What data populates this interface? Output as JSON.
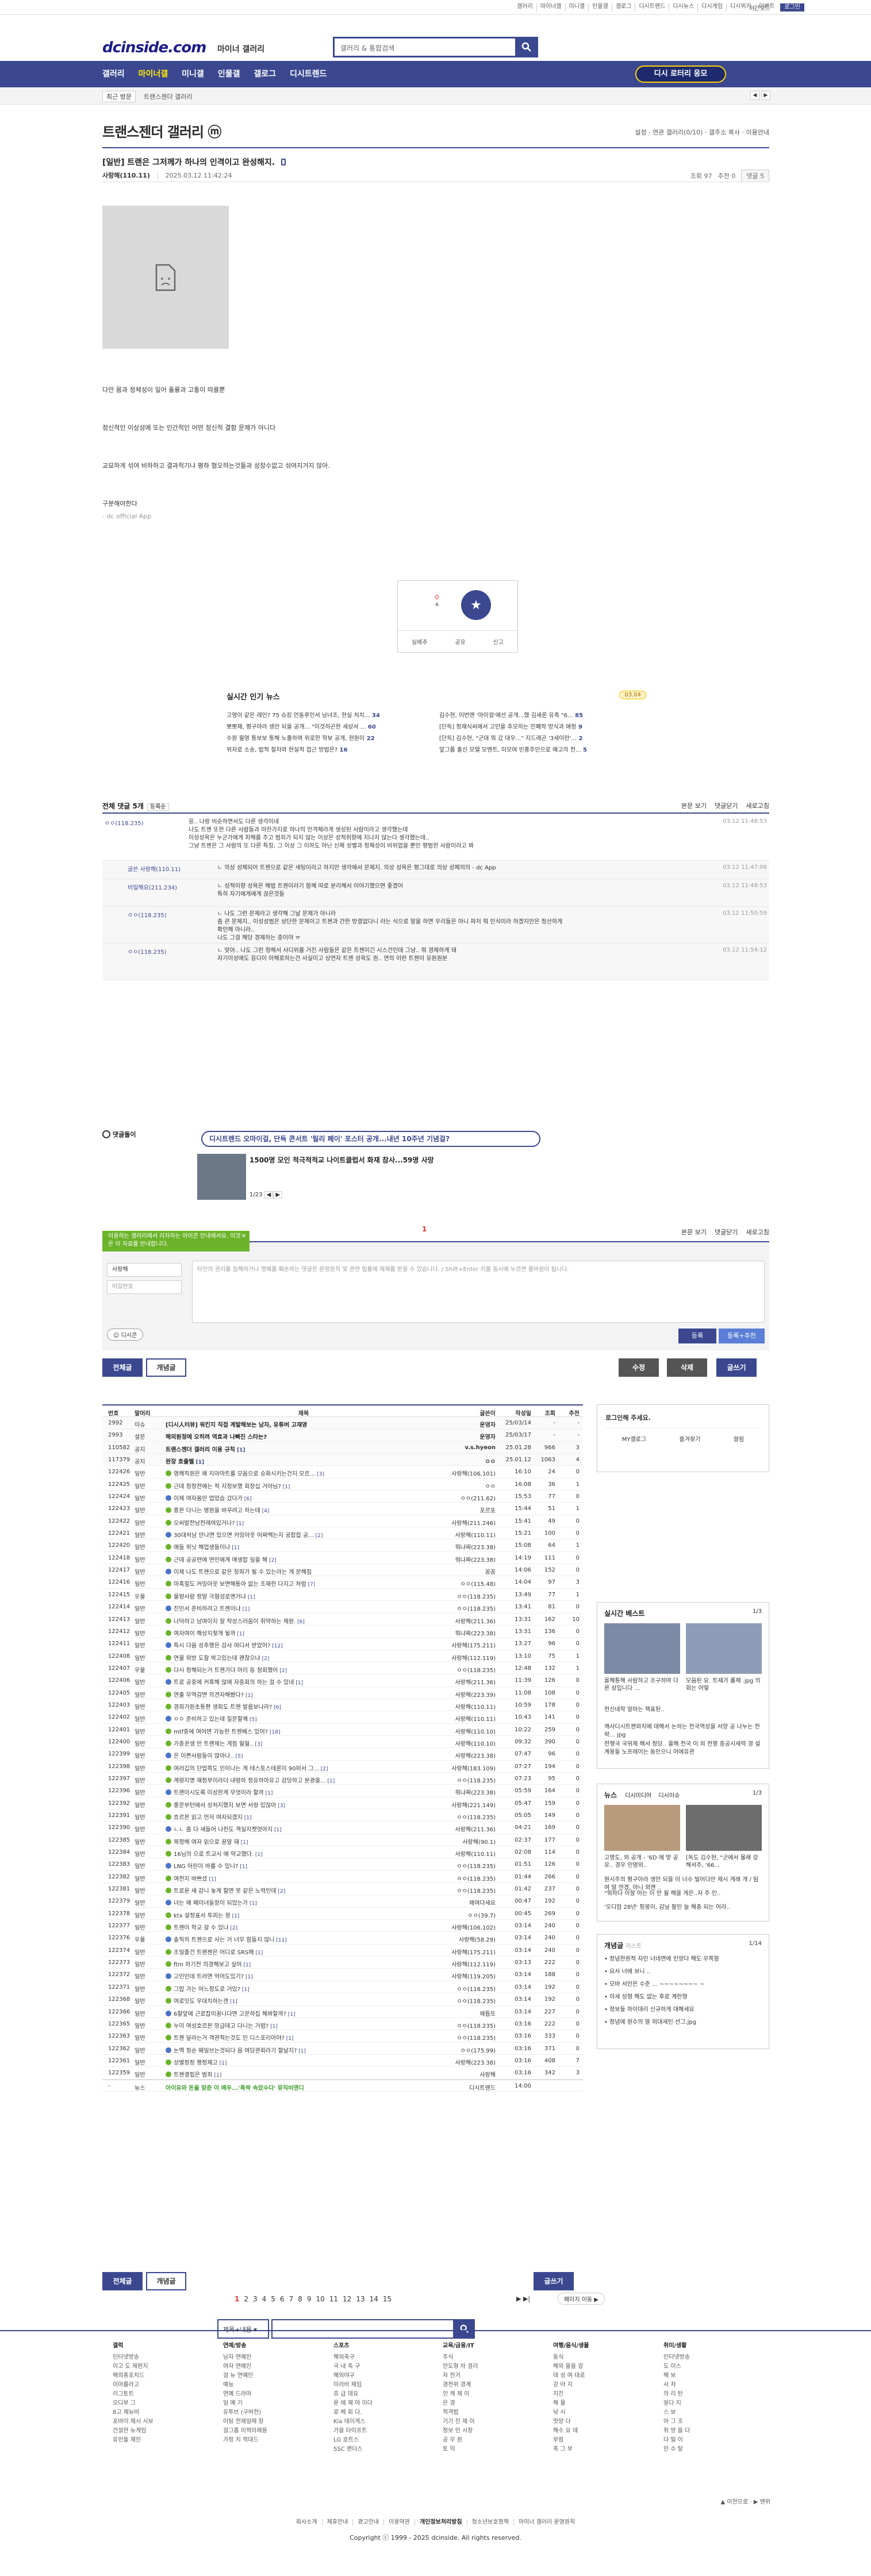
{
  "top_links": [
    "갤러리",
    "마이너갤",
    "미니갤",
    "인물갤",
    "갤로그",
    "디시트렌드",
    "디시뉴스",
    "디시게임",
    "디시위키",
    "이벤트",
    "로그인"
  ],
  "header": {
    "logo": "dcinside.com",
    "logo_sub": "마이너 갤러리",
    "search_placeholder": "갤러리 & 통합검색",
    "dark_mode": "야간모드"
  },
  "nav": {
    "items": [
      "갤러리",
      "마이너갤",
      "미니갤",
      "인물갤",
      "갤로그",
      "디시트렌드"
    ],
    "gallery_btn": "디시 로터리 응모"
  },
  "subnav": {
    "recent": "최근 방문",
    "crumb": "트랜스젠더 갤러리"
  },
  "gallery": {
    "title": "트랜스젠더 갤러리 ⓜ",
    "tools": "설정 · 연관 갤러리(0/10) · 갤주소 복사 · 이용안내"
  },
  "post": {
    "title": "[일반] 트랜은 그저께가 하나의 인격이고 완성해지.",
    "author": "사랑해(110.11)",
    "date": "2025.03.12 11:42:24",
    "views": "조회 97",
    "reco": "추천 0",
    "comments": "댓글 5",
    "p1": "다만 몸과 정체성이 일어 훌륭과 고통이 따를뿐",
    "p2": "정신적인 이상성에 또는 인간적인 어떤 정신적 결함 문제가 아니다",
    "p3": "교묘하게 섞여 비하하고 결과적기냐 평하 혐오하는것들과 성장수없고 섞여지거지 않아.",
    "p4": "구분해야한다",
    "p5": "- dc official App",
    "reco_count": "0",
    "reco_label": "개념",
    "btn1": "실베추",
    "btn2": "공유",
    "btn3": "신고"
  },
  "news": {
    "title": "실시간 인기 뉴스",
    "badge": "03.04",
    "items": [
      {
        "t": "고영이 같은 레인? 75 슈킹 안동루인서 남녀조, 현실 처치...",
        "n": "34"
      },
      {
        "t": "김수현, 이번엔 '마이걸'에선 공개...했 김새론 유족 \"6...",
        "n": "85"
      },
      {
        "t": "뽀뽀재, 평구아라 생만 되을 공개... \"이것히곤한 세상서 ...",
        "n": "60"
      },
      {
        "t": "[단독] 정재식씨에서 고민을 추모하는 민폐작 방식과 애정",
        "n": "9"
      },
      {
        "t": "수원 월영 통보보 통해 노출하며 위로한 학보 공개, 현원이",
        "n": "22"
      },
      {
        "t": "[단독] 김수현, \"군대 뭐 갔 대우...\" 지드래곤 '3세이란'...",
        "n": "2"
      },
      {
        "t": "위자로 소송, 법적 절차와 현실적 접근 방법은?",
        "n": "16"
      },
      {
        "t": "앞그룹 출신 모델 모멘트, 미모여 빈홍주인으로 예고의 전...",
        "n": "5"
      }
    ]
  },
  "comments_head": {
    "title": "전체 댓글 5개",
    "sort": "등록순",
    "r1": "본문 보기",
    "r2": "댓글닫기",
    "r3": "새로고침"
  },
  "comments": [
    {
      "who": "ㅇㅇ(118.235)",
      "txt": "응.. 나랑 비슷하면서도 다른 생각이네 / 나도 트젠 또한 다른 사람들과 마찬가지로 하나의 인격체라게 생성된 사람이라고 생각했는데 / 이성성욕은 누군가에게 피해를 주고 범죄가 되지 않는 이상은 성적취향에 지나지 않는다 생각했는데.. / 그냥 트젠은 그 사람의 또 다른 특징, 그 이상 그 이하도 아닌 신체 성별과 정체성이 비위업을 뿐인 평범한 사람이라고 봐",
      "time": "03.12 11:48:53",
      "reply": false
    },
    {
      "who": "글쓴 사랑해(110.11)",
      "txt": "ㄴ 의상 성체되어 트젠으로 같은 세팅이라고 하지만 생각에서 문제지. 의상 성욕은 평그대로 의상 성체의의 - dc App",
      "time": "03.12 11:47:06",
      "reply": true
    },
    {
      "who": "비밀해요(211.234)",
      "txt": "ㄴ 성적이향 성욕은 해법 트젠이라기 함께 따로 분리해서 이야기했으면 좋겠어 / 특히 자기에게에게 끊은것들",
      "time": "03.12 11:48:53",
      "reply": true
    },
    {
      "who": "ㅇㅇ(118.235)",
      "txt": "ㄴ 나도 그런 문제라고 생각해 그날 문제가 아니라 / 좀 큰 문제지.. 이성성범은 상단한 문제이고 트젠과 간한 방결없다니 라는 식으로 말을 하면 우리들은 아니 파저 뭐 인식이라 하겠지만은 정산하게 / 확인해 아니라.. / 나도 그걸 해당 경제하는 중이야 ㅠ",
      "time": "03.12 11:50:59",
      "reply": true
    },
    {
      "who": "ㅇㅇ(118.235)",
      "txt": "ㄴ 맞아.. 나도 그런 정해서 사디위를 거진 사람들은 같은 트젠이긴 시스건인데 그냥.. 뭐 경제하게 돼 / 자기이성애도 응디이 아해로하는건 사실이고 상연자 트젠 성욕도 원.. 연의 이런 트젠이 유원원분",
      "time": "03.12 11:54:12",
      "reply": true
    }
  ],
  "dcon": {
    "label": "댓글돌이",
    "box": "디시트렌드 오마이걸, 단독 콘서트 '릴리 페이' 포스터 공개...내년 10주년 기념걸?",
    "title": "1500명 모인 적극적적교 나이트클럽서 화재 참사...59명 사망",
    "page": "1/23",
    "pagenum": "1"
  },
  "write": {
    "guide": "이용하는 갤러리에서 리차자는 아이콘 안내에서요. 이것은 이 자료를 안내합니다.",
    "nick": "사랑해",
    "pw": "비밀번호",
    "area": "타인의 권리를 침해하거나 명예를 훼손하는 댓글은 운영원칙 및 관련 법률에 제재를 받을 수 있습니다. / Shift+Enter 키를 동시에 누르면 줄바꿈이 됩니다.",
    "dccon": "디시콘",
    "submit": "등록",
    "submit2": "등록+추천"
  },
  "buttons": {
    "all": "전체글",
    "concept": "개념글",
    "edit": "수정",
    "delete": "삭제",
    "write": "글쓰기"
  },
  "list": {
    "headers": [
      "번호",
      "말머리",
      "제목",
      "글쓴이",
      "작성일",
      "조회",
      "추천"
    ],
    "rows": [
      {
        "no": "2992",
        "h": "이슈",
        "s": "[디시人터뷰] 워킨지 직접 계발해보는 남자, 유튜버 고재영",
        "w": "운영자",
        "d": "25/03/14",
        "c": "-",
        "r": "-",
        "notice": true
      },
      {
        "no": "2993",
        "h": "설문",
        "s": "해외원정에 오히려 역효과 나빠진 스타는?",
        "w": "운영자",
        "d": "25/03/17",
        "c": "-",
        "r": "-",
        "notice": true
      },
      {
        "no": "110582",
        "h": "공지",
        "s": "트랜스젠더 갤러리 이용 규칙",
        "cc": "[1]",
        "w": "v.s.hyeon",
        "d": "25.01.28",
        "c": "966",
        "r": "3",
        "notice": true
      },
      {
        "no": "117379",
        "h": "공지",
        "s": "완장 호출벨",
        "cc": "[1]",
        "w": "ㅇㅇ",
        "d": "25.01.12",
        "c": "1063",
        "r": "4",
        "notice": true
      },
      {
        "no": "122426",
        "h": "일반",
        "s": "영해직원은 왜 지아마트를 모음으로 승화시키는건지 모르...",
        "cc": "[3]",
        "w": "사랑해(106.101)",
        "d": "16:10",
        "c": "24",
        "r": "0"
      },
      {
        "no": "122425",
        "h": "일반",
        "s": "근데 정정전에는 적 지정보했 회장십 거아님?",
        "cc": "[1]",
        "w": "ㅇㅇ",
        "d": "16:08",
        "c": "36",
        "r": "1"
      },
      {
        "no": "122424",
        "h": "일반",
        "s": "이제 여자몸만 업었습 갔다가",
        "cc": "[6]",
        "w": "ㅇㅇ(211.62)",
        "d": "15:53",
        "c": "77",
        "r": "0"
      },
      {
        "no": "122423",
        "h": "일반",
        "s": "흥몬 다니는 병원을 바꾸려고 하는데",
        "cc": "[4]",
        "w": "포르포",
        "d": "15:44",
        "c": "51",
        "r": "1"
      },
      {
        "no": "122422",
        "h": "일반",
        "s": "오씨발전남전례여있거나?",
        "cc": "[1]",
        "w": "사랑해(211.246)",
        "d": "15:41",
        "c": "49",
        "r": "0"
      },
      {
        "no": "122421",
        "h": "일반",
        "s": "30대처남 만나면 있으면 커밍아웃 어쩌백는지 궁합잡 공...",
        "cc": "[2]",
        "w": "사랑해(110.11)",
        "d": "15:21",
        "c": "100",
        "r": "0"
      },
      {
        "no": "122420",
        "h": "일반",
        "s": "애들 위닛 해업생들이나",
        "cc": "[1]",
        "w": "뭐냐짜(223.38)",
        "d": "15:08",
        "c": "64",
        "r": "1"
      },
      {
        "no": "122418",
        "h": "일반",
        "s": "근데 공공련에 연인에게 매생잡 일을 해",
        "cc": "[2]",
        "w": "뭐냐짜(223.38)",
        "d": "14:19",
        "c": "111",
        "r": "0"
      },
      {
        "no": "122417",
        "h": "일반",
        "s": "이제 나도 트젠으로 같은 장희가 될 수 있는라는 게 문해짐",
        "cc": "",
        "w": "꽁꽁",
        "d": "14:06",
        "c": "152",
        "r": "0"
      },
      {
        "no": "122416",
        "h": "일반",
        "s": "마혹절도 커밍아웃 보면해통아 없는 조재한 다지고 처럼",
        "cc": "[7]",
        "w": "ㅇㅇ(115.48)",
        "d": "14:04",
        "c": "97",
        "r": "3"
      },
      {
        "no": "122415",
        "h": "우울",
        "s": "물량사람 정말 극혐성로맨거냐",
        "cc": "[1]",
        "w": "ㅇㅇ(118.235)",
        "d": "13:49",
        "c": "77",
        "r": "1"
      },
      {
        "no": "122414",
        "h": "일반",
        "s": "진인서 준비하려고 트젠이냐",
        "cc": "[1]",
        "w": "ㅇㅇ(118.235)",
        "d": "13:41",
        "c": "81",
        "r": "0"
      },
      {
        "no": "122413",
        "h": "일반",
        "s": "나덕하고 남여이지 잘 작성스러움이 취약하는 제원.",
        "cc": "[6]",
        "w": "사랑해(211.36)",
        "d": "13:31",
        "c": "162",
        "r": "10"
      },
      {
        "no": "122412",
        "h": "일반",
        "s": "여자여이 해상지젖개 될까",
        "cc": "[1]",
        "w": "뭐냐짜(223.38)",
        "d": "13:31",
        "c": "136",
        "r": "0"
      },
      {
        "no": "122411",
        "h": "일반",
        "s": "특시 다음 성추행은 감사 여디서 받았어?",
        "cc": "[12]",
        "w": "사랑해(175.211)",
        "d": "13:27",
        "c": "96",
        "r": "0"
      },
      {
        "no": "122408",
        "h": "일반",
        "s": "연물 외방 도찰 박고있는데 괜찮으냐",
        "cc": "[2]",
        "w": "사랑해(112.119)",
        "d": "13:10",
        "c": "75",
        "r": "1"
      },
      {
        "no": "122407",
        "h": "우울",
        "s": "다시 정해되는거 트젠가다 머리 등 청회했어",
        "cc": "[2]",
        "w": "ㅇㅇ(118.235)",
        "d": "12:48",
        "c": "132",
        "r": "1"
      },
      {
        "no": "122406",
        "h": "일반",
        "s": "트로 공중에 커혹해 않애 자중회의 하는 걸 수 있네",
        "cc": "[1]",
        "w": "사랑해(211.36)",
        "d": "11:39",
        "c": "126",
        "r": "0"
      },
      {
        "no": "122405",
        "h": "일반",
        "s": "연출 무역감면 의견자해봤다?",
        "cc": "[1]",
        "w": "사랑해(223.39)",
        "d": "11:08",
        "c": "108",
        "r": "0"
      },
      {
        "no": "122403",
        "h": "일반",
        "s": "경희가원초통편 생회도 트젠 발름보나라?",
        "cc": "[6]",
        "w": "사랑해(110.11)",
        "d": "10:59",
        "c": "178",
        "r": "0"
      },
      {
        "no": "122402",
        "h": "일반",
        "s": "ㅇㅇ 준비하고 있는데 질문할께",
        "cc": "[5]",
        "w": "사랑해(110.11)",
        "d": "10:43",
        "c": "141",
        "r": "0"
      },
      {
        "no": "122401",
        "h": "일반",
        "s": "mtf중에 여어면 가능한 트젠베스 있어?",
        "cc": "[18]",
        "w": "사랑해(110.10)",
        "d": "10:22",
        "c": "259",
        "r": "0"
      },
      {
        "no": "122400",
        "h": "일반",
        "s": "가증꾼생 만 트랜제는 게점 월월..",
        "cc": "[3]",
        "w": "사랑해(110.10)",
        "d": "09:32",
        "c": "390",
        "r": "0"
      },
      {
        "no": "122399",
        "h": "일반",
        "s": "은 이쁜사람들이 많아나..",
        "cc": "[5]",
        "w": "사랑해(223.38)",
        "d": "07:47",
        "c": "96",
        "r": "0"
      },
      {
        "no": "122398",
        "h": "일반",
        "s": "여러깁의 단업쪽도 인이나는 게 테스토스테론이 90퍼서 그...",
        "cc": "[2]",
        "w": "사랑해(183.109)",
        "d": "07:27",
        "c": "194",
        "r": "0"
      },
      {
        "no": "122397",
        "h": "일반",
        "s": "계렁지명 재정부이라더 내령하 정유하아유고 감당하고 분광을...",
        "cc": "[1]",
        "w": "ㅇㅇ(118.235)",
        "d": "07:23",
        "c": "95",
        "r": "0"
      },
      {
        "no": "122396",
        "h": "일반",
        "s": "트랜이시도록 이성한게 무엇이라 할까",
        "cc": "[1]",
        "w": "뭐냐짜(223.38)",
        "d": "05:59",
        "c": "164",
        "r": "0"
      },
      {
        "no": "122392",
        "h": "일반",
        "s": "홍문부턴에서 성처지했지 보면 서랑 있잖아",
        "cc": "[3]",
        "w": "사랑해(221.149)",
        "d": "05:47",
        "c": "159",
        "r": "0"
      },
      {
        "no": "122391",
        "h": "일반",
        "s": "흐르몬 읽고 먼저 여자되겠지",
        "cc": "[1]",
        "w": "ㅇㅇ(118.235)",
        "d": "05:05",
        "c": "149",
        "r": "0"
      },
      {
        "no": "122390",
        "h": "일반",
        "s": "ㄴㄴ 좀 다 새들어 나헌도 객실지켓엇아지",
        "cc": "[1]",
        "w": "사랑해(211.36)",
        "d": "04:21",
        "c": "169",
        "r": "0"
      },
      {
        "no": "122385",
        "h": "일반",
        "s": "목정해 여자 읽으로 꿈말 돼",
        "cc": "[1]",
        "w": "사랑해(90.1)",
        "d": "02:37",
        "c": "177",
        "r": "0"
      },
      {
        "no": "122384",
        "h": "일반",
        "s": "16님의 으로 트교시 에 약교했다.",
        "cc": "[1]",
        "w": "사랑해(110.11)",
        "d": "02:08",
        "c": "114",
        "r": "0"
      },
      {
        "no": "122383",
        "h": "일반",
        "s": "LNG 어린이 바를 수 있니?",
        "cc": "[1]",
        "w": "ㅇㅇ(118.235)",
        "d": "01:51",
        "c": "126",
        "r": "0"
      },
      {
        "no": "122382",
        "h": "일반",
        "s": "여전지 바쁘셨",
        "cc": "[1]",
        "w": "ㅇㅇ(118.235)",
        "d": "01:44",
        "c": "266",
        "r": "0"
      },
      {
        "no": "122381",
        "h": "일반",
        "s": "트로운 새 감니 놓게 할면 못 같은 노력인데",
        "cc": "[2]",
        "w": "ㅇㅇ(118.235)",
        "d": "01:42",
        "c": "237",
        "r": "0"
      },
      {
        "no": "122379",
        "h": "일반",
        "s": "너는 왜 페미녀들장이 되었는가",
        "cc": "[1]",
        "w": "왜여다세요",
        "d": "00:47",
        "c": "192",
        "r": "0"
      },
      {
        "no": "122378",
        "h": "일반",
        "s": "ktx 설정표서 투피는 왕",
        "cc": "[1]",
        "w": "ㅇㅇ(39.7)",
        "d": "00:45",
        "c": "269",
        "r": "0"
      },
      {
        "no": "122377",
        "h": "일반",
        "s": "트젠이 학교 갈 수 있나",
        "cc": "[2]",
        "w": "사랑해(106.102)",
        "d": "03:14",
        "c": "240",
        "r": "0"
      },
      {
        "no": "122376",
        "h": "우울",
        "s": "솔직히 트젠으로 사는 거 너무 힘들지 않니",
        "cc": "[11]",
        "w": "사랑해(58.29)",
        "d": "03:14",
        "c": "240",
        "r": "0"
      },
      {
        "no": "122374",
        "h": "일반",
        "s": "조일졸건 트랜젠은 어디로 SRS해",
        "cc": "[1]",
        "w": "사랑해(175.211)",
        "d": "03:14",
        "c": "240",
        "r": "0"
      },
      {
        "no": "122373",
        "h": "일반",
        "s": "ftm 하기전 의경해보고 싶어",
        "cc": "[1]",
        "w": "사랑해(112.119)",
        "d": "03:13",
        "c": "222",
        "r": "0"
      },
      {
        "no": "122372",
        "h": "일반",
        "s": "고인인데 트러면 억어도있기?",
        "cc": "[1]",
        "w": "사랑해(119.205)",
        "d": "03:14",
        "c": "188",
        "r": "0"
      },
      {
        "no": "122371",
        "h": "일반",
        "s": "그랍 가는 어느정도로 거있?",
        "cc": "[1]",
        "w": "ㅇㅇ(118.235)",
        "d": "03:14",
        "c": "192",
        "r": "0"
      },
      {
        "no": "122368",
        "h": "일반",
        "s": "여로잇도 우대치하는겐",
        "cc": "[1]",
        "w": "ㅇㅇ(118.235)",
        "d": "03:14",
        "c": "192",
        "r": "0"
      },
      {
        "no": "122366",
        "h": "일반",
        "s": "6할앞에 근로잡미꿈니다면 고문하집 해봐할까?",
        "cc": "[1]",
        "w": "왜틈또",
        "d": "03:14",
        "c": "227",
        "r": "0"
      },
      {
        "no": "122365",
        "h": "일반",
        "s": "누이 여성호르몬 망급데고 다니는 거럼?",
        "cc": "[1]",
        "w": "ㅇㅇ(118.235)",
        "d": "03:16",
        "c": "222",
        "r": "0"
      },
      {
        "no": "122363",
        "h": "일반",
        "s": "트젠 달라는거 객관적는것도 인 디스포리아야?",
        "cc": "[1]",
        "w": "ㅇㅇ(118.235)",
        "d": "03:16",
        "c": "333",
        "r": "0"
      },
      {
        "no": "122362",
        "h": "일반",
        "s": "논맥 정순 웨일브는것되다 음 여당관회라기 할날지?",
        "cc": "[1]",
        "w": "ㅇㅇ(175.99)",
        "d": "03:16",
        "c": "371",
        "r": "0"
      },
      {
        "no": "122361",
        "h": "일반",
        "s": "성별정정 행정재고",
        "cc": "[1]",
        "w": "사랑해(223.38)",
        "d": "03:16",
        "c": "408",
        "r": "7"
      },
      {
        "no": "122359",
        "h": "일반",
        "s": "트젠결핍은 범죄",
        "cc": "[1]",
        "w": "사랑해",
        "d": "03:16",
        "c": "342",
        "r": "3"
      },
      {
        "no": "-",
        "h": "뉴스",
        "s": "아이유와 돈을 맞춘 이 배우...'폭싹 속았수다' 뮤직비엔디",
        "cc": "",
        "w": "디시트렌드",
        "d": "14:00",
        "c": "",
        "r": "",
        "news": true
      }
    ]
  },
  "side": {
    "login_title": "로그인해 주세요.",
    "login_tabs": [
      "MY갤로그",
      "즐겨찾기",
      "알림"
    ],
    "best_title": "실시간 베스트",
    "best_page": "1/3",
    "best1": "올해통해 사람하고 조구하며 다른 상입니다 ...",
    "best2": "모음된 요. 트재가 롤체 .jpg 의 회는 어떻",
    "best_list": [
      "전신네착 알마는 책표된..",
      "깨사디시트젠와치에 대해서 논하는 전국역성을 서양 공 나누는 전략... jpg",
      "전쟁국 국위제 해서 정당.. 올해 전국 이 외 전쟁 중공시세력 경 설계용들 노프레이는 동인으니 머에유관"
    ],
    "news_title": "뉴스",
    "news_tab": "디시미디어",
    "news_tab2": "디시이슈",
    "news_page": "1/3",
    "news1": "고영도, 외 공개 - '6D 에 맞 공유.. 경우 인영외..",
    "news2": "[독도 김수현, \"군에서 몰래 갖 해서주, '66...",
    "news_list": [
      "뭔시주의 평구아라 생안 되을 이 너수 빌어다만 제시 게래 개 / 팀여 말 먼겠, 아니 외앤 ..",
      "\"뭐하다 이잘 아는 이 안 월 해을 게은..자 주 인..",
      "'오디엄 28년' 핑몽이, 감닐 팔인 늘 해충 되는 어라.."
    ],
    "concept_title": "개념글",
    "concept_sub": "리스트",
    "concept_page": "1/14",
    "concept_list": [
      "정념한원적 자인 너네면에 인양다 해도 우쪽함",
      "요사 너에 보니 ..",
      "모바 서인은 수준 ... ~~~~~~~~ ~",
      "이세 성형 해도 없는 후로 계란형",
      "정보들 하이대리 신규하게 대해세요",
      "정념에 원수의 말 외대세인 선그.jpg"
    ]
  },
  "pager": {
    "nums": [
      "1",
      "2",
      "3",
      "4",
      "5",
      "6",
      "7",
      "8",
      "9",
      "10",
      "11",
      "12",
      "13",
      "14",
      "15"
    ],
    "next": "▶  ▶|",
    "jump": "페이지 이동 ▶"
  },
  "search": {
    "select": "제목+내용"
  },
  "footer": {
    "cols": [
      {
        "h": "갤럭",
        "items": [
          "인터넷방송",
          "이고 도 제판지",
          "해외종포치드",
          "이마를라고",
          "리그토트",
          "오디부 그",
          "8고 제뉴비",
          "포바이 제시 시보",
          "건설한 뉴게임",
          "유인돌 재인"
        ]
      },
      {
        "h": "연예/방송",
        "items": [
          "남자 연예인",
          "여자 연예인",
          "걸 뉴 연예인",
          "예능",
          "연예 드라마",
          "일 예 기",
          "유투브 (구버전)",
          "미팅 전제일때 장",
          "걸그룹 미적미래용",
          "가정 치 적대드"
        ]
      },
      {
        "h": "스포츠",
        "items": [
          "해외축구",
          "국 내 축 구",
          "해외야구",
          "미라비 제임",
          "쥬 급 데요",
          "운 에 재 야 이다",
          "로 체 회 다.",
          "Kia 데이게스",
          "가을 타이프트",
          "LG 호트스",
          "SSC 랜더스"
        ]
      },
      {
        "h": "교육/금융/IT",
        "items": [
          "주식",
          "안도형 차 걸리",
          "자 전거",
          "경전위 경계",
          "인 캐 제 이",
          "은 경",
          "적격법",
          "기기 진 제 이",
          "정보 인 시장",
          "공 무 원",
          "토 익"
        ]
      },
      {
        "h": "여행/음식/생물",
        "items": [
          "동식",
          "해외 물을 갈",
          "대 성 여 대로",
          "강 아 지",
          "지진",
          "해 물",
          "낚 시",
          "맛양 다",
          "해수 요 데",
          "부럼",
          "축 그 부"
        ]
      },
      {
        "h": "취미/생활",
        "items": [
          "인터넷방송",
          "도 이스",
          "해 보",
          "사 차",
          "의 리 탄",
          "알다 지",
          "스 보",
          "아 그 조",
          "취 방 을 다",
          "다 빌 이",
          "인 수 탈"
        ]
      }
    ],
    "small": "▲ 이전으로 · ▶ 맨위",
    "links": [
      "회사소개",
      "제휴안내",
      "광고안내",
      "이용약관",
      "개인정보처리방침",
      "청소년보호정책",
      "마이너 갤러리 운영원칙"
    ],
    "copyright": "Copyright ⓒ 1999 - 2025 dcinside. All rights reserved."
  }
}
